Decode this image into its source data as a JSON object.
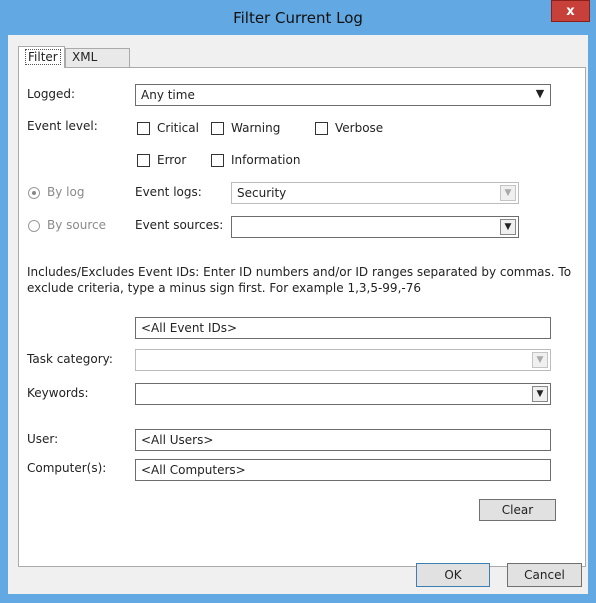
{
  "window": {
    "title": "Filter Current Log",
    "close_label": "x"
  },
  "tabs": [
    {
      "label": "Filter"
    },
    {
      "label": "XML"
    }
  ],
  "filter": {
    "logged_label": "Logged:",
    "logged_value": "Any time",
    "event_level_label": "Event level:",
    "levels": [
      {
        "label": "Critical",
        "checked": false
      },
      {
        "label": "Warning",
        "checked": false
      },
      {
        "label": "Verbose",
        "checked": false
      },
      {
        "label": "Error",
        "checked": false
      },
      {
        "label": "Information",
        "checked": false
      }
    ],
    "by_log_label": "By log",
    "by_source_label": "By source",
    "event_logs_label": "Event logs:",
    "event_logs_value": "Security",
    "event_sources_label": "Event sources:",
    "event_sources_value": "",
    "event_ids_help": "Includes/Excludes Event IDs: Enter ID numbers and/or ID ranges separated by commas. To exclude criteria, type a minus sign first. For example 1,3,5-99,-76",
    "event_ids_value": "<All Event IDs>",
    "task_category_label": "Task category:",
    "keywords_label": "Keywords:",
    "user_label": "User:",
    "user_value": "<All Users>",
    "computer_label": "Computer(s):",
    "computer_value": "<All Computers>",
    "clear_label": "Clear"
  },
  "buttons": {
    "ok": "OK",
    "cancel": "Cancel"
  },
  "colors": {
    "titlebar": "#62a8e2",
    "close": "#c7413a",
    "dialog_bg": "#f0f0f0"
  }
}
